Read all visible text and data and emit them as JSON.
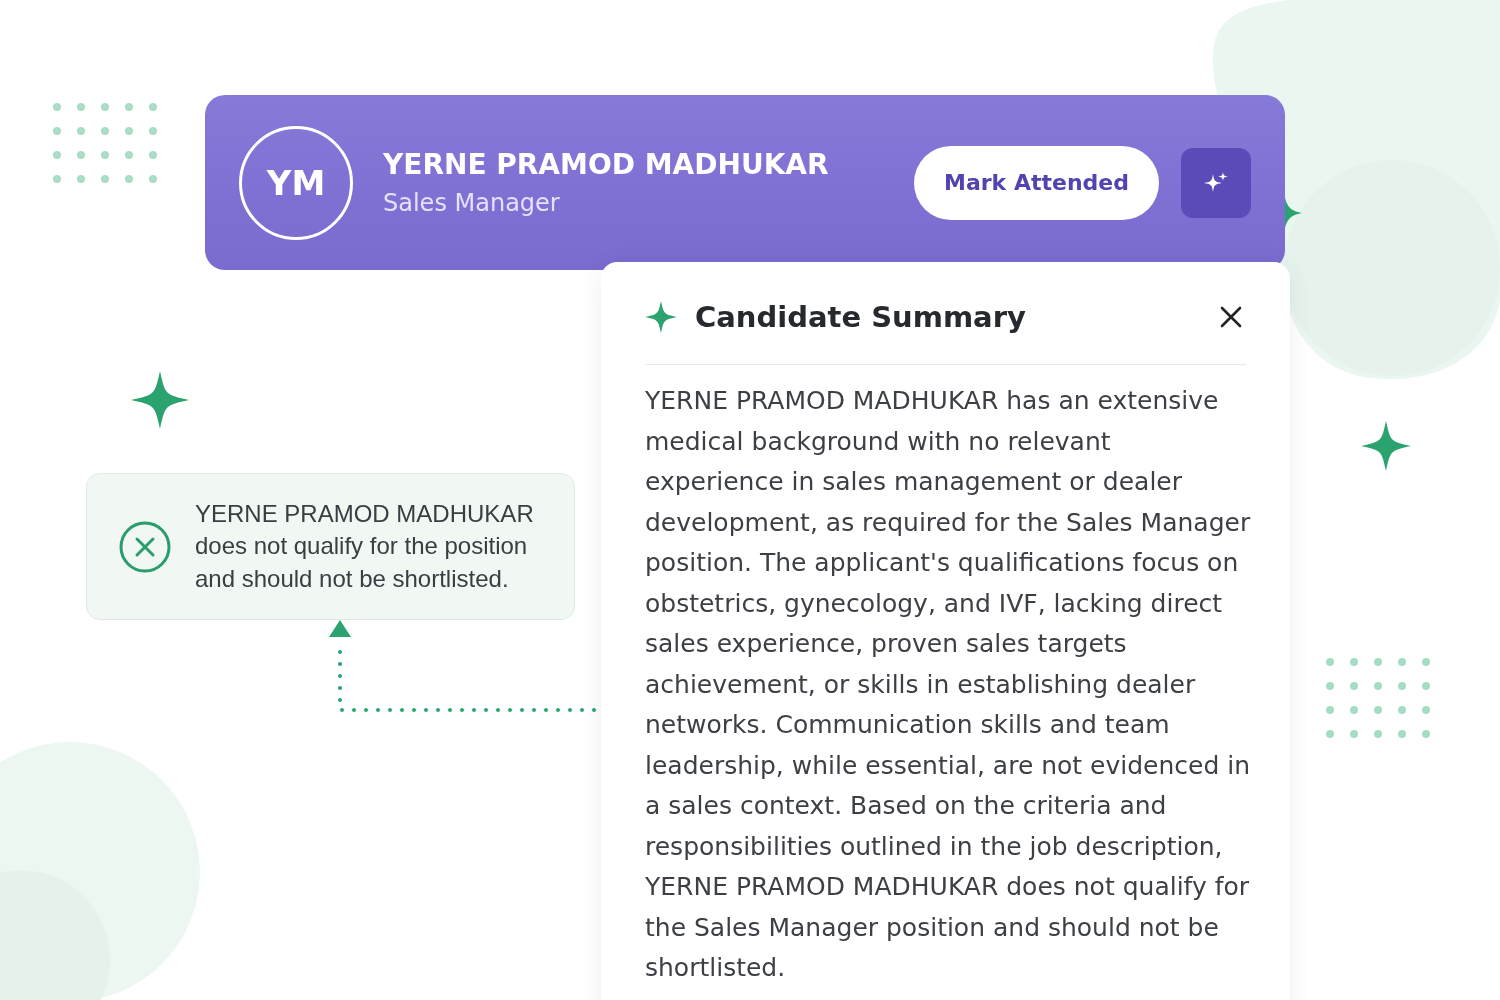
{
  "candidate_card": {
    "initials": "YM",
    "name": "YERNE PRAMOD MADHUKAR",
    "role": "Sales Manager",
    "action_button": {
      "label": "Mark Attended"
    }
  },
  "verdict": {
    "qualified": false,
    "text": "YERNE PRAMOD MADHUKAR does not qualify for the position and should not be shortlisted."
  },
  "summary_panel": {
    "title": "Candidate Summary",
    "body": "YERNE PRAMOD MADHUKAR has an extensive medical background with no relevant experience in sales management or dealer development, as required for the Sales Manager position. The applicant's qualifications focus on obstetrics, gynecology, and IVF, lacking direct sales experience, proven sales targets achievement, or skills in establishing dealer networks. Communication skills and team leadership, while essential, are not evidenced in a sales context. Based on the criteria and responsibilities outlined in the job description, YERNE PRAMOD MADHUKAR does not qualify for the Sales Manager position and should not be shortlisted."
  }
}
